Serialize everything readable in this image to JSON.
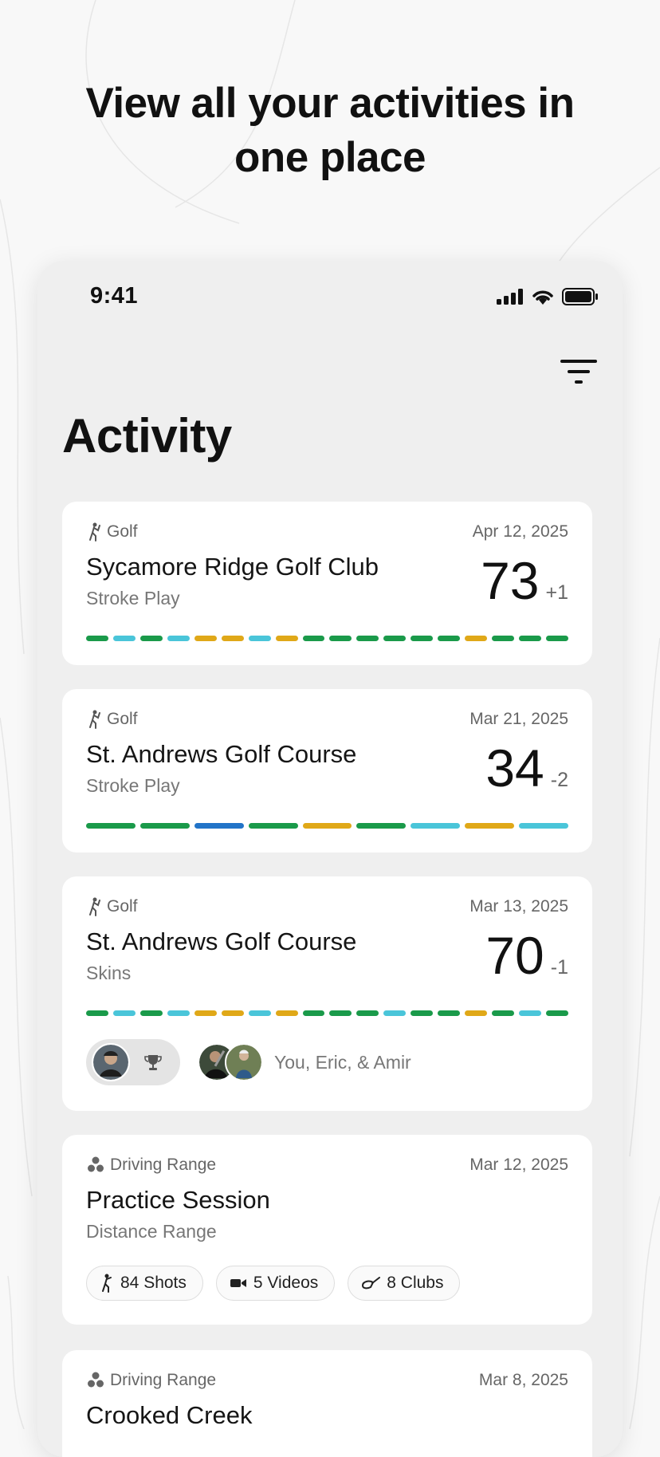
{
  "headline": {
    "line1": "View all your activities in",
    "line2": "one place"
  },
  "status_bar": {
    "time": "9:41",
    "icons": [
      "signal-icon",
      "wifi-icon",
      "battery-icon"
    ]
  },
  "header": {
    "title": "Activity",
    "filter_icon": "filter-icon"
  },
  "hole_colors": {
    "green": "#1a9a4a",
    "cyan": "#4ac5d9",
    "gold": "#e0a818",
    "blue": "#2274c8"
  },
  "activities": [
    {
      "sport": "Golf",
      "date": "Apr 12, 2025",
      "course": "Sycamore Ridge Golf Club",
      "mode": "Stroke Play",
      "score": "73",
      "relative": "+1",
      "holes": [
        "green",
        "cyan",
        "green",
        "cyan",
        "gold",
        "gold",
        "cyan",
        "gold",
        "green",
        "green",
        "green",
        "green",
        "green",
        "green",
        "gold",
        "green",
        "green",
        "green"
      ]
    },
    {
      "sport": "Golf",
      "date": "Mar 21, 2025",
      "course": "St. Andrews Golf Course",
      "mode": "Stroke Play",
      "score": "34",
      "relative": "-2",
      "holes": [
        "green",
        "green",
        "blue",
        "green",
        "gold",
        "green",
        "cyan",
        "gold",
        "cyan"
      ]
    },
    {
      "sport": "Golf",
      "date": "Mar 13, 2025",
      "course": "St. Andrews Golf Course",
      "mode": "Skins",
      "score": "70",
      "relative": "-1",
      "holes": [
        "green",
        "cyan",
        "green",
        "cyan",
        "gold",
        "gold",
        "cyan",
        "gold",
        "green",
        "green",
        "green",
        "cyan",
        "green",
        "green",
        "gold",
        "green",
        "cyan",
        "green"
      ],
      "players": "You, Eric, & Amir"
    },
    {
      "sport": "Driving Range",
      "date": "Mar 12, 2025",
      "course": "Practice Session",
      "mode": "Distance Range",
      "chips": [
        {
          "icon": "golfer-swing-icon",
          "label": "84 Shots"
        },
        {
          "icon": "video-camera-icon",
          "label": "5 Videos"
        },
        {
          "icon": "golf-club-icon",
          "label": "8 Clubs"
        }
      ]
    },
    {
      "sport": "Driving Range",
      "date": "Mar 8, 2025",
      "course": "Crooked Creek"
    }
  ]
}
